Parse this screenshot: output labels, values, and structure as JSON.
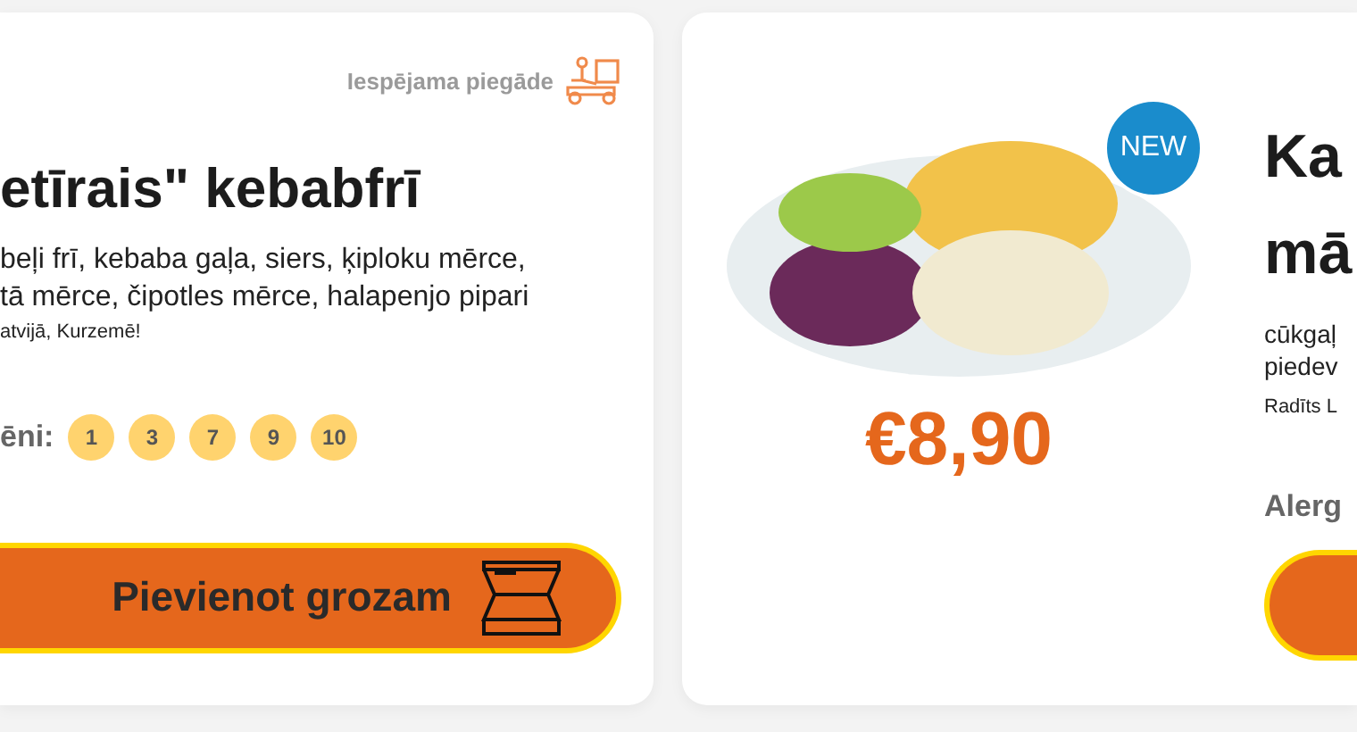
{
  "left_card": {
    "delivery": {
      "label": "Iespējama piegāde"
    },
    "title": "etīrais\" kebabfrī",
    "description": "beļi frī, kebaba gaļa, siers, ķiploku mērce,\ntā mērce, čipotles mērce, halapenjo pipari",
    "origin": "atvijā, Kurzemē!",
    "allergens": {
      "label": "ēni:",
      "items": [
        "1",
        "3",
        "7",
        "9",
        "10"
      ]
    },
    "button": "Pievienot grozam"
  },
  "right_card": {
    "badge": "NEW",
    "price": "€8,90",
    "title": "Ka\nmā",
    "description": "cūkgaļ\npiedev",
    "origin": "Radīts L",
    "allergens_label": "Alerg"
  }
}
